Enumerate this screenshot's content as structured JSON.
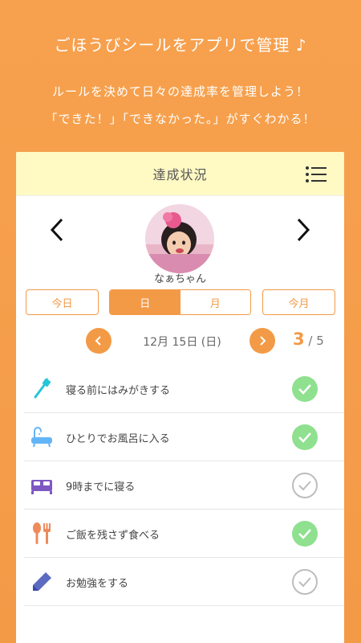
{
  "promo": {
    "headline": "ごほうびシールをアプリで管理 ♪",
    "line1": "ルールを決めて日々の達成率を管理しよう！",
    "line2": "「できた！」「できなかった。」がすぐわかる！"
  },
  "card": {
    "title": "達成状況",
    "child_name": "なぁちゃん",
    "tabs": {
      "today": "今日",
      "day": "日",
      "month": "月",
      "this_month": "今月"
    },
    "date": "12月 15日 (日)",
    "score_done": "3",
    "score_total": "/ 5"
  },
  "tasks": [
    {
      "label": "寝る前にはみがきする",
      "icon": "toothbrush-icon",
      "done": true
    },
    {
      "label": "ひとりでお風呂に入る",
      "icon": "bathtub-icon",
      "done": true
    },
    {
      "label": "9時までに寝る",
      "icon": "bed-icon",
      "done": false
    },
    {
      "label": "ご飯を残さず食べる",
      "icon": "spoon-fork-icon",
      "done": true
    },
    {
      "label": "お勉強をする",
      "icon": "pencil-icon",
      "done": false
    }
  ],
  "colors": {
    "accent": "#f39a47",
    "header_bg": "#fff9c4",
    "check_done": "#8fe08f",
    "check_undone": "#bdbdbd"
  }
}
